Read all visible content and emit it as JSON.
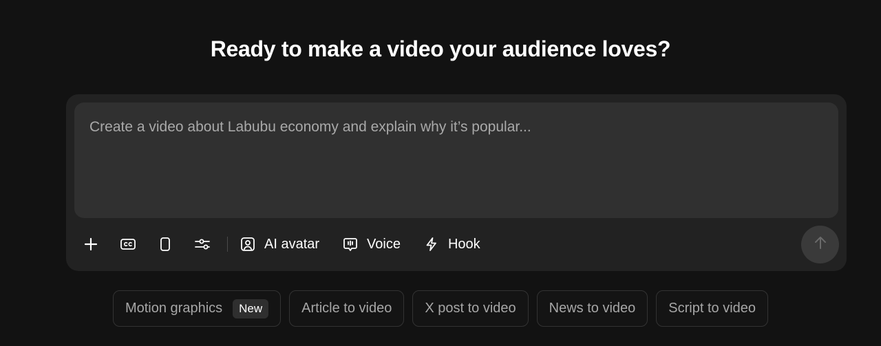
{
  "headline": "Ready to make a video your audience loves?",
  "composer": {
    "placeholder": "Create a video about Labubu economy and explain why it’s popular...",
    "value": ""
  },
  "toolbar": {
    "icons": [
      "plus-icon",
      "captions-icon",
      "phone-aspect-icon",
      "sliders-icon"
    ],
    "avatar_label": "AI avatar",
    "voice_label": "Voice",
    "hook_label": "Hook"
  },
  "send": {
    "icon": "arrow-up-icon"
  },
  "chips": [
    {
      "label": "Motion graphics",
      "badge": "New"
    },
    {
      "label": "Article to video"
    },
    {
      "label": "X post to video"
    },
    {
      "label": "News to video"
    },
    {
      "label": "Script to video"
    }
  ],
  "colors": {
    "background": "#121212",
    "composer": "#222222",
    "input": "#303030",
    "send_button": "#3a3a3a",
    "chip_border": "#333333"
  }
}
